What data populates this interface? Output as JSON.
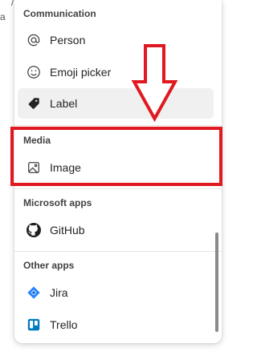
{
  "sections": [
    {
      "header": "Communication",
      "items": [
        {
          "label": "Person",
          "icon": "at-icon"
        },
        {
          "label": "Emoji picker",
          "icon": "smiley-icon"
        },
        {
          "label": "Label",
          "icon": "tag-icon",
          "selected": true
        }
      ]
    },
    {
      "header": "Media",
      "items": [
        {
          "label": "Image",
          "icon": "image-icon"
        }
      ]
    },
    {
      "header": "Microsoft apps",
      "items": [
        {
          "label": "GitHub",
          "icon": "github-icon"
        }
      ]
    },
    {
      "header": "Other apps",
      "items": [
        {
          "label": "Jira",
          "icon": "jira-icon"
        },
        {
          "label": "Trello",
          "icon": "trello-icon"
        }
      ]
    }
  ],
  "colors": {
    "annotation_red": "#e0181f",
    "jira_blue": "#2684ff",
    "trello_blue": "#0079bf",
    "selected_bg": "#f0f0f0"
  }
}
